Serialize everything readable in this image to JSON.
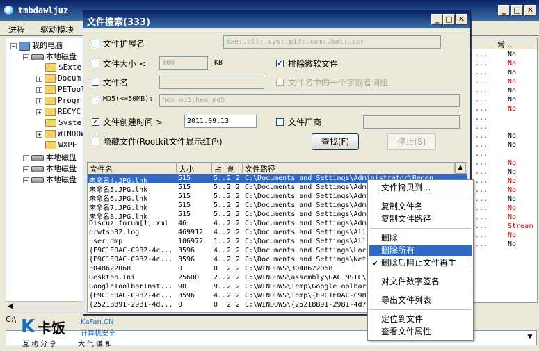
{
  "main_window": {
    "title": "tmbdawljuz",
    "menu": [
      "进程",
      "驱动模块"
    ],
    "status_text": "C:\\"
  },
  "tree": {
    "items": [
      {
        "label": "我的电脑",
        "icon": "computer-icon"
      },
      {
        "label": "本地磁盘",
        "icon": "drive-icon"
      },
      {
        "label": "$Exte",
        "icon": "folder-icon"
      },
      {
        "label": "Docum",
        "icon": "folder-icon"
      },
      {
        "label": "PETool",
        "icon": "folder-icon"
      },
      {
        "label": "Progr",
        "icon": "folder-icon"
      },
      {
        "label": "RECYC",
        "icon": "folder-icon"
      },
      {
        "label": "Syster",
        "icon": "folder-icon"
      },
      {
        "label": "WINDOW",
        "icon": "folder-icon"
      },
      {
        "label": "WXPE",
        "icon": "folder-icon"
      },
      {
        "label": "本地磁盘",
        "icon": "drive-icon"
      },
      {
        "label": "本地磁盘",
        "icon": "drive-icon"
      },
      {
        "label": "本地磁盘",
        "icon": "drive-icon"
      }
    ]
  },
  "right_list": {
    "header": "常...",
    "rows": [
      {
        "dots": "...",
        "value": "No",
        "red": false
      },
      {
        "dots": "...",
        "value": "No",
        "red": true
      },
      {
        "dots": "...",
        "value": "No",
        "red": false
      },
      {
        "dots": "...",
        "value": "No",
        "red": true
      },
      {
        "dots": "...",
        "value": "No",
        "red": false
      },
      {
        "dots": "...",
        "value": "No",
        "red": false
      },
      {
        "dots": "...",
        "value": "No",
        "red": true
      },
      {
        "dots": "...",
        "value": "",
        "red": false
      },
      {
        "dots": "...",
        "value": "",
        "red": false
      },
      {
        "dots": "...",
        "value": "No",
        "red": false
      },
      {
        "dots": "...",
        "value": "No",
        "red": false
      },
      {
        "dots": "...",
        "value": "",
        "red": false
      },
      {
        "dots": "...",
        "value": "No",
        "red": true
      },
      {
        "dots": "...",
        "value": "No",
        "red": false
      },
      {
        "dots": "...",
        "value": "No",
        "red": true
      },
      {
        "dots": "...",
        "value": "No",
        "red": true
      },
      {
        "dots": "...",
        "value": "No",
        "red": false
      },
      {
        "dots": "...",
        "value": "No",
        "red": true
      },
      {
        "dots": "...",
        "value": "No",
        "red": true
      },
      {
        "dots": "...",
        "value": "Stream",
        "red": true
      },
      {
        "dots": "...",
        "value": "No",
        "red": true
      },
      {
        "dots": "...",
        "value": "No",
        "red": false
      }
    ]
  },
  "dialog": {
    "title": "文件搜索(333)",
    "ext_label": "文件扩展名",
    "ext_value": "exe;.dll;.sys;.pif;.com;.bat;.scr",
    "size_label": "文件大小 <",
    "size_value": "100",
    "size_unit": "KB",
    "exclude_ms_label": "排除微软文件",
    "exclude_ms_checked": true,
    "name_label": "文件名",
    "name_value": "",
    "name_part_label": "文件名中的一个字或者词组",
    "md5_label": "MD5(<=50MB):",
    "md5_value": "hex_md5;hex_md5",
    "ctime_label": "文件创建时间 >",
    "ctime_checked": true,
    "ctime_value": "2011.09.13",
    "vendor_label": "文件厂商",
    "vendor_value": "",
    "hidden_label": "隐藏文件(Rootkit文件显示红色)",
    "find_button": "查找(F)",
    "stop_button": "停止(S)",
    "columns": [
      "文件名",
      "大小",
      "占",
      "创",
      "文件路径"
    ],
    "rows": [
      {
        "name": "未命名4.JPG.lnk",
        "size": "515",
        "a": "5..",
        "b": "2",
        "c": "2",
        "path": "C:\\Documents and Settings\\Administrator\\Recen",
        "selected": true
      },
      {
        "name": "未命名5.JPG.lnk",
        "size": "515",
        "a": "5..",
        "b": "2",
        "c": "2",
        "path": "C:\\Documents and Settings\\Adm",
        "selected": false
      },
      {
        "name": "未命名6.JPG.lnk",
        "size": "515",
        "a": "5..",
        "b": "2",
        "c": "2",
        "path": "C:\\Documents and Settings\\Adm",
        "selected": false
      },
      {
        "name": "未命名7.JPG.lnk",
        "size": "515",
        "a": "5..",
        "b": "2",
        "c": "2",
        "path": "C:\\Documents and Settings\\Adm",
        "selected": false
      },
      {
        "name": "未命名8.JPG.lnk",
        "size": "515",
        "a": "5..",
        "b": "2",
        "c": "2",
        "path": "C:\\Documents and Settings\\Adm",
        "selected": false
      },
      {
        "name": "Discuz_forum[1].xml",
        "size": "46",
        "a": "4..",
        "b": "2",
        "c": "2",
        "path": "C:\\Documents and Settings\\Adm",
        "selected": false
      },
      {
        "name": "drwtsn32.log",
        "size": "469912",
        "a": "4..",
        "b": "2",
        "c": "2",
        "path": "C:\\Documents and Settings\\All",
        "selected": false
      },
      {
        "name": "user.dmp",
        "size": "106972",
        "a": "1..",
        "b": "2",
        "c": "2",
        "path": "C:\\Documents and Settings\\All",
        "selected": false
      },
      {
        "name": "{E9C1E0AC-C9B2-4c...",
        "size": "3596",
        "a": "4..",
        "b": "2",
        "c": "2",
        "path": "C:\\Documents and Settings\\Loc",
        "selected": false
      },
      {
        "name": "{E9C1E0AC-C9B2-4c...",
        "size": "3596",
        "a": "4..",
        "b": "2",
        "c": "2",
        "path": "C:\\Documents and Settings\\Net",
        "selected": false
      },
      {
        "name": "3048622068",
        "size": "0",
        "a": "0",
        "b": "2",
        "c": "2",
        "path": "C:\\WINDOWS\\3048622068",
        "selected": false
      },
      {
        "name": "Desktop.ini",
        "size": "25600",
        "a": "2..",
        "b": "2",
        "c": "2",
        "path": "C:\\WINDOWS\\assembly\\GAC_MSIL\\",
        "selected": false
      },
      {
        "name": "GoogleToolbarInst...",
        "size": "90",
        "a": "9..",
        "b": "2",
        "c": "2",
        "path": "C:\\WINDOWS\\Temp\\GoogleToolbar",
        "selected": false
      },
      {
        "name": "{E9C1E0AC-C9B2-4c...",
        "size": "3596",
        "a": "4..",
        "b": "2",
        "c": "2",
        "path": "C:\\WINDOWS\\Temp\\{E9C1E0AC-C9B",
        "selected": false
      },
      {
        "name": "{2521BB91-29B1-4d...",
        "size": "0",
        "a": "0",
        "b": "2",
        "c": "2",
        "path": "C:\\WINDOWS\\{2521BB91-29B1-4d7",
        "selected": false
      }
    ]
  },
  "context_menu": {
    "items": [
      {
        "label": "文件拷贝到...",
        "checked": false,
        "highlighted": false
      },
      {
        "label": "复制文件名",
        "checked": false,
        "highlighted": false
      },
      {
        "label": "复制文件路径",
        "checked": false,
        "highlighted": false
      },
      {
        "label": "删除",
        "checked": false,
        "highlighted": false
      },
      {
        "label": "删除所有",
        "checked": false,
        "highlighted": true
      },
      {
        "label": "删除后阻止文件再生",
        "checked": true,
        "highlighted": false
      },
      {
        "label": "对文件数字签名",
        "checked": false,
        "highlighted": false
      },
      {
        "label": "导出文件列表",
        "checked": false,
        "highlighted": false
      },
      {
        "label": "定位到文件",
        "checked": false,
        "highlighted": false
      },
      {
        "label": "查看文件属性",
        "checked": false,
        "highlighted": false
      }
    ]
  },
  "watermark": {
    "brand_k": "K",
    "brand_cn": "卡饭",
    "brand_en": "KaFan.CN",
    "brand_sub": "计算机安全",
    "slogan_left": "互动分享",
    "slogan_right": "大气谦和"
  },
  "colors": {
    "title_bar": "#0a246a",
    "selection": "#316ac5",
    "red_text": "#c00000",
    "brand_blue": "#1b6fc4"
  }
}
